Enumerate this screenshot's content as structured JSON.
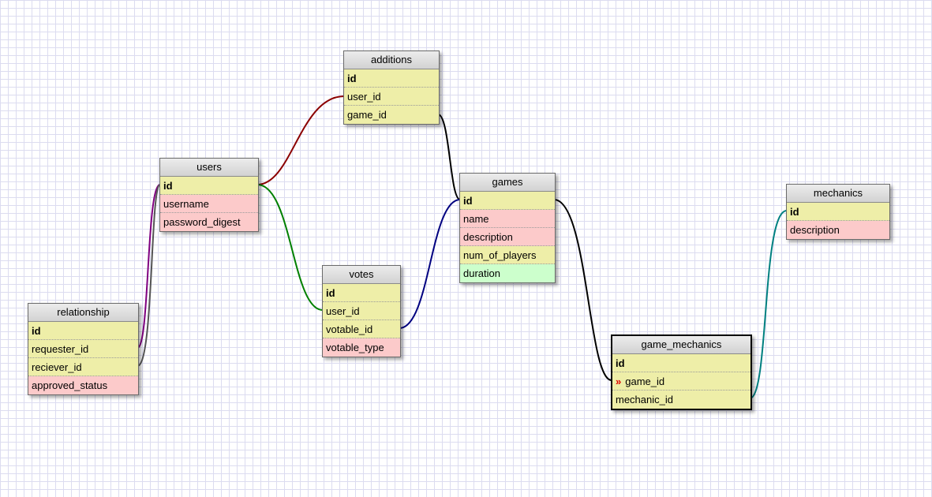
{
  "tables": {
    "additions": {
      "title": "additions",
      "rows": [
        {
          "label": "id",
          "pk": true,
          "color": "yellow"
        },
        {
          "label": "user_id",
          "color": "yellow"
        },
        {
          "label": "game_id",
          "color": "yellow"
        }
      ]
    },
    "users": {
      "title": "users",
      "rows": [
        {
          "label": "id",
          "pk": true,
          "color": "yellow"
        },
        {
          "label": "username",
          "color": "pink"
        },
        {
          "label": "password_digest",
          "color": "pink"
        }
      ]
    },
    "games": {
      "title": "games",
      "rows": [
        {
          "label": "id",
          "pk": true,
          "color": "yellow"
        },
        {
          "label": "name",
          "color": "pink"
        },
        {
          "label": "description",
          "color": "pink"
        },
        {
          "label": "num_of_players",
          "color": "yellow"
        },
        {
          "label": "duration",
          "color": "green"
        }
      ]
    },
    "mechanics": {
      "title": "mechanics",
      "rows": [
        {
          "label": "id",
          "pk": true,
          "color": "yellow"
        },
        {
          "label": "description",
          "color": "pink"
        }
      ]
    },
    "votes": {
      "title": "votes",
      "rows": [
        {
          "label": "id",
          "pk": true,
          "color": "yellow"
        },
        {
          "label": "user_id",
          "color": "yellow"
        },
        {
          "label": "votable_id",
          "color": "yellow"
        },
        {
          "label": "votable_type",
          "color": "pink"
        }
      ]
    },
    "relationship": {
      "title": "relationship",
      "rows": [
        {
          "label": "id",
          "pk": true,
          "color": "yellow"
        },
        {
          "label": "requester_id",
          "color": "yellow"
        },
        {
          "label": "reciever_id",
          "color": "yellow"
        },
        {
          "label": "approved_status",
          "color": "pink"
        }
      ]
    },
    "game_mechanics": {
      "title": "game_mechanics",
      "rows": [
        {
          "label": "id",
          "pk": true,
          "color": "yellow"
        },
        {
          "label": "game_id",
          "color": "yellow",
          "fk_icon": true
        },
        {
          "label": "mechanic_id",
          "color": "yellow"
        }
      ]
    }
  },
  "colors": {
    "users_additions": "#8b0000",
    "users_votes": "#008000",
    "additions_games": "#000000",
    "votes_games": "#000080",
    "games_game_mechanics": "#000000",
    "mechanics_game_mechanics": "#008080",
    "users_relationship": "#800080",
    "users_relationship_2": "#555555"
  }
}
